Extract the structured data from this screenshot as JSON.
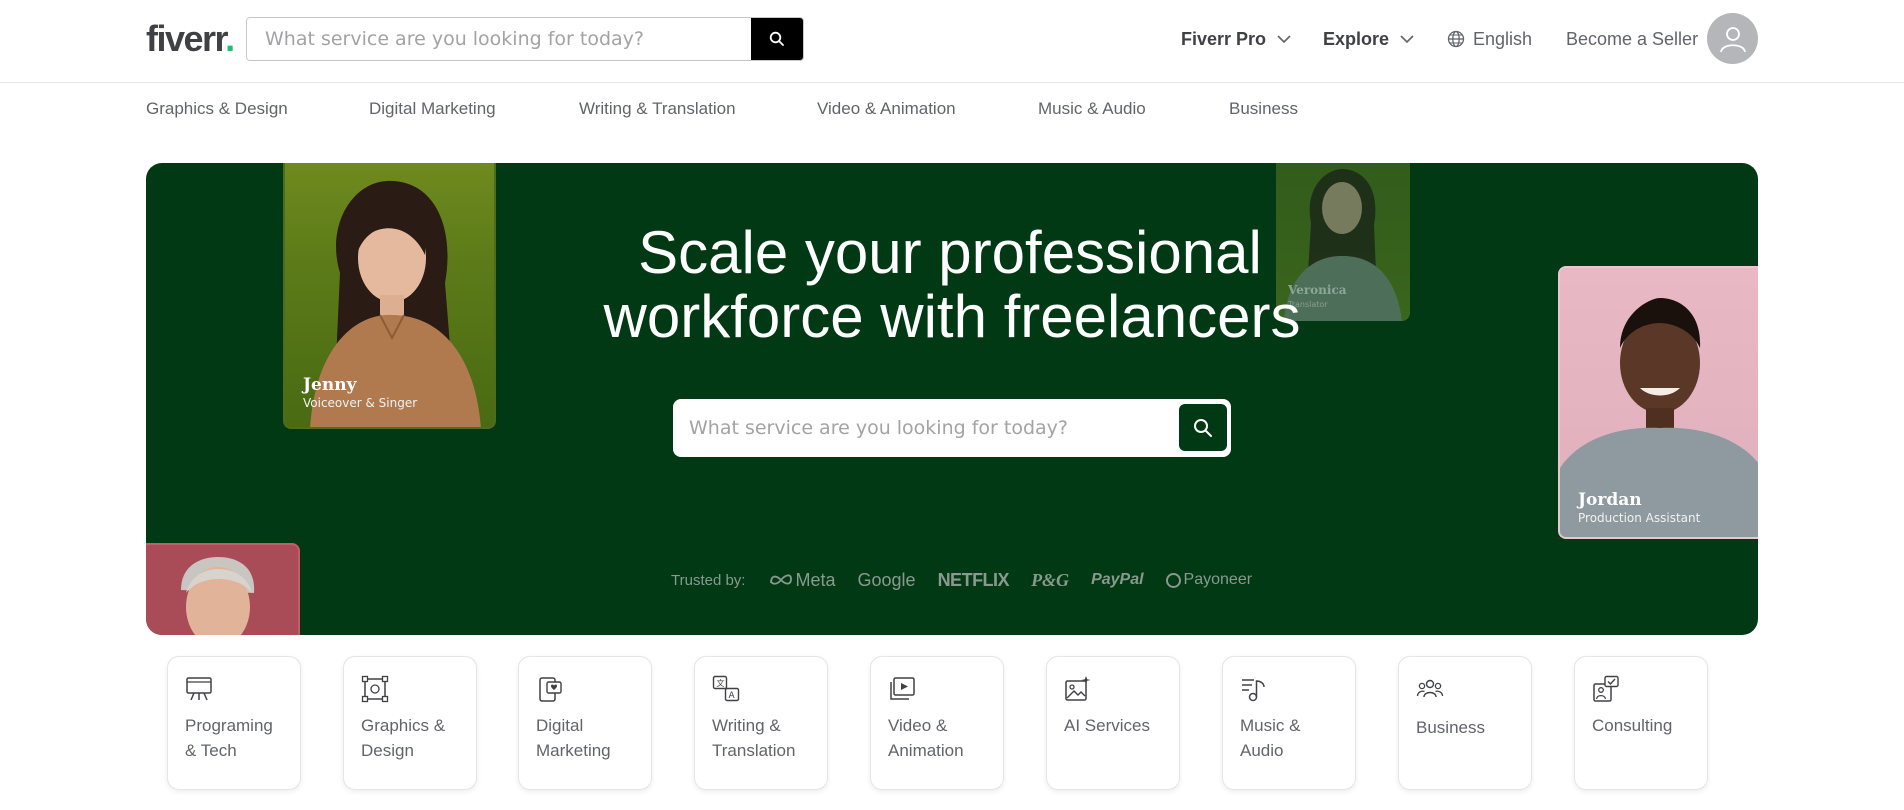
{
  "header": {
    "logo_text": "fiverr",
    "logo_dot": ".",
    "search_placeholder": "What service are you looking for today?",
    "nav": {
      "pro": "Fiverr Pro",
      "explore": "Explore",
      "language": "English",
      "become_seller": "Become a Seller"
    }
  },
  "categories_bar": [
    "Graphics & Design",
    "Digital Marketing",
    "Writing & Translation",
    "Video & Animation",
    "Music & Audio",
    "Business"
  ],
  "hero": {
    "title_line1": "Scale your professional",
    "title_line2": "workforce with freelancers",
    "search_placeholder": "What service are you looking for today?",
    "trusted_label": "Trusted by:",
    "brands": {
      "meta": "Meta",
      "google": "Google",
      "netflix": "NETFLIX",
      "pg": "P&G",
      "paypal": "PayPal",
      "payoneer": "Payoneer"
    },
    "cards": {
      "jenny": {
        "name": "Jenny",
        "role": "Voiceover & Singer"
      },
      "veronica": {
        "name": "Veronica",
        "role": "Translator"
      },
      "jordan": {
        "name": "Jordan",
        "role": "Production Assistant"
      }
    },
    "colors": {
      "background": "#013914",
      "button": "#013914"
    }
  },
  "tiles": [
    {
      "line1": "Programing",
      "line2": "& Tech",
      "icon": "presentation-board-icon"
    },
    {
      "line1": "Graphics &",
      "line2": "Design",
      "icon": "vector-design-icon"
    },
    {
      "line1": "Digital",
      "line2": "Marketing",
      "icon": "phone-heart-icon"
    },
    {
      "line1": "Writing &",
      "line2": "Translation",
      "icon": "translate-icon"
    },
    {
      "line1": "Video &",
      "line2": "Animation",
      "icon": "video-play-icon"
    },
    {
      "line1": "AI Services",
      "line2": "",
      "icon": "ai-image-icon"
    },
    {
      "line1": "Music &",
      "line2": "Audio",
      "icon": "music-note-icon"
    },
    {
      "line1": "Business",
      "line2": "",
      "icon": "people-group-icon"
    },
    {
      "line1": "Consulting",
      "line2": "",
      "icon": "consulting-chat-icon"
    }
  ]
}
